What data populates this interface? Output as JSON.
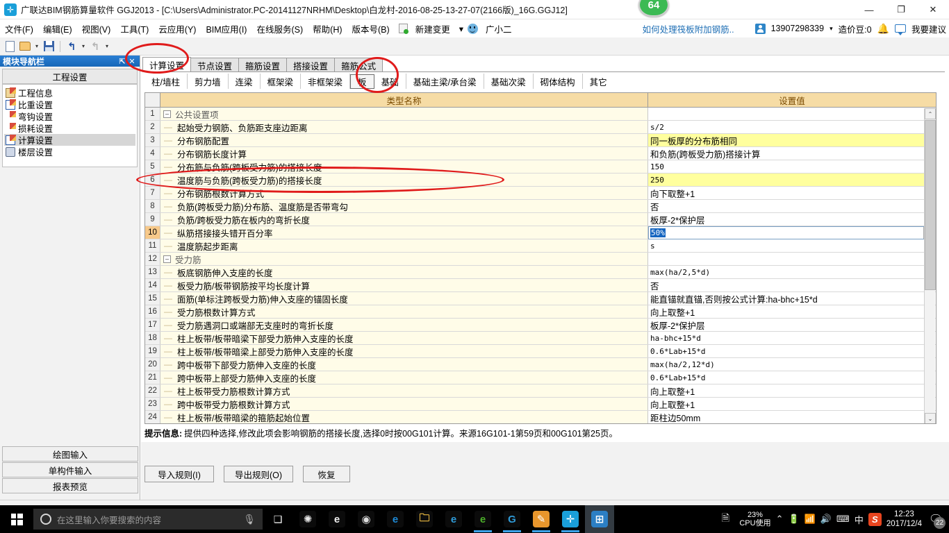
{
  "titlebar": {
    "app_title": "广联达BIM钢筋算量软件 GGJ2013 - [C:\\Users\\Administrator.PC-20141127NRHM\\Desktop\\白龙村-2016-08-25-13-27-07(2166版)_16G.GGJ12]",
    "badge": "64",
    "minimize": "—",
    "maximize": "❐",
    "close": "✕"
  },
  "menubar": {
    "items": [
      "文件(F)",
      "编辑(E)",
      "视图(V)",
      "工具(T)",
      "云应用(Y)",
      "BIM应用(I)",
      "在线服务(S)",
      "帮助(H)",
      "版本号(B)"
    ],
    "new_change": "新建变更",
    "new_change_caret": "▾",
    "assistant": "广小二",
    "right": {
      "promo_link": "如何处理筏板附加钢筋..",
      "account": "13907298339",
      "account_caret": "▾",
      "coins": "造价豆:0",
      "suggest": "我要建议"
    }
  },
  "toolbar": {
    "new": "new-document",
    "open": "open-folder",
    "save": "save-disk",
    "undo": "undo-arrow",
    "redo": "redo-arrow",
    "caret": "▾"
  },
  "left_panel": {
    "header_title": "模块导航栏",
    "pin": "⇱",
    "close": "✕",
    "group_title": "工程设置",
    "tree": [
      {
        "label": "工程信息"
      },
      {
        "label": "比重设置"
      },
      {
        "label": "弯钩设置"
      },
      {
        "label": "损耗设置"
      },
      {
        "label": "计算设置",
        "selected": true
      },
      {
        "label": "楼层设置"
      }
    ],
    "bottom_buttons": [
      "绘图输入",
      "单构件输入",
      "报表预览"
    ]
  },
  "tabs_primary": [
    {
      "label": "计算设置",
      "active": true
    },
    {
      "label": "节点设置",
      "active": false
    },
    {
      "label": "箍筋设置",
      "active": false
    },
    {
      "label": "搭接设置",
      "active": false
    },
    {
      "label": "箍筋公式",
      "active": false
    }
  ],
  "tabs_secondary": [
    {
      "label": "柱/墙柱",
      "active": false
    },
    {
      "label": "剪力墙",
      "active": false
    },
    {
      "label": "连梁",
      "active": false
    },
    {
      "label": "框架梁",
      "active": false
    },
    {
      "label": "非框架梁",
      "active": false
    },
    {
      "label": "板",
      "active": true
    },
    {
      "label": "基础",
      "active": false
    },
    {
      "label": "基础主梁/承台梁",
      "active": false
    },
    {
      "label": "基础次梁",
      "active": false
    },
    {
      "label": "砌体结构",
      "active": false
    },
    {
      "label": "其它",
      "active": false
    }
  ],
  "grid": {
    "columns": [
      "类型名称",
      "设置值"
    ],
    "rows": [
      {
        "n": "1",
        "kind": "group",
        "name": "公共设置项",
        "value": ""
      },
      {
        "n": "2",
        "kind": "item",
        "name": "起始受力钢筋、负筋距支座边距离",
        "value": "s/2"
      },
      {
        "n": "3",
        "kind": "item",
        "name": "分布钢筋配置",
        "value": "同一板厚的分布筋相同",
        "highlight": true,
        "cjk": true
      },
      {
        "n": "4",
        "kind": "item",
        "name": "分布钢筋长度计算",
        "value": "和负筋(跨板受力筋)搭接计算",
        "cjk": true
      },
      {
        "n": "5",
        "kind": "item",
        "name": "分布筋与负筋(跨板受力筋)的搭接长度",
        "value": "150"
      },
      {
        "n": "6",
        "kind": "item",
        "name": "温度筋与负筋(跨板受力筋)的搭接长度",
        "value": "250",
        "highlight": true
      },
      {
        "n": "7",
        "kind": "item",
        "name": "分布钢筋根数计算方式",
        "value": "向下取整+1",
        "cjk": true
      },
      {
        "n": "8",
        "kind": "item",
        "name": "负筋(跨板受力筋)分布筋、温度筋是否带弯勾",
        "value": "否",
        "cjk": true
      },
      {
        "n": "9",
        "kind": "item",
        "name": "负筋/跨板受力筋在板内的弯折长度",
        "value": "板厚-2*保护层",
        "cjk": true
      },
      {
        "n": "10",
        "kind": "combo",
        "name": "纵筋搭接接头错开百分率",
        "value": "50%",
        "current": true
      },
      {
        "n": "11",
        "kind": "item",
        "name": "温度筋起步距离",
        "value": "s"
      },
      {
        "n": "12",
        "kind": "group",
        "name": "受力筋",
        "value": ""
      },
      {
        "n": "13",
        "kind": "item",
        "name": "板底钢筋伸入支座的长度",
        "value": "max(ha/2,5*d)"
      },
      {
        "n": "14",
        "kind": "item",
        "name": "板受力筋/板带钢筋按平均长度计算",
        "value": "否",
        "cjk": true
      },
      {
        "n": "15",
        "kind": "item",
        "name": "面筋(单标注跨板受力筋)伸入支座的锚固长度",
        "value": "能直锚就直锚,否则按公式计算:ha-bhc+15*d",
        "cjk": true
      },
      {
        "n": "16",
        "kind": "item",
        "name": "受力筋根数计算方式",
        "value": "向上取整+1",
        "cjk": true
      },
      {
        "n": "17",
        "kind": "item",
        "name": "受力筋遇洞口或端部无支座时的弯折长度",
        "value": "板厚-2*保护层",
        "cjk": true
      },
      {
        "n": "18",
        "kind": "item",
        "name": "柱上板带/板带暗梁下部受力筋伸入支座的长度",
        "value": "ha-bhc+15*d"
      },
      {
        "n": "19",
        "kind": "item",
        "name": "柱上板带/板带暗梁上部受力筋伸入支座的长度",
        "value": "0.6*Lab+15*d"
      },
      {
        "n": "20",
        "kind": "item",
        "name": "跨中板带下部受力筋伸入支座的长度",
        "value": "max(ha/2,12*d)"
      },
      {
        "n": "21",
        "kind": "item",
        "name": "跨中板带上部受力筋伸入支座的长度",
        "value": "0.6*Lab+15*d"
      },
      {
        "n": "22",
        "kind": "item",
        "name": "柱上板带受力筋根数计算方式",
        "value": "向上取整+1",
        "cjk": true
      },
      {
        "n": "23",
        "kind": "item",
        "name": "跨中板带受力筋根数计算方式",
        "value": "向上取整+1",
        "cjk": true
      },
      {
        "n": "24",
        "kind": "item",
        "name": "柱上板带/板带暗梁的箍筋起始位置",
        "value": "距柱边50mm",
        "cjk": true
      }
    ],
    "scroll": {
      "up": "⌃",
      "down": "⌄"
    }
  },
  "hint": {
    "label": "提示信息:",
    "text": "提供四种选择,修改此项会影响钢筋的搭接长度,选择0时按00G101计算。来源16G101-1第59页和00G101第25页。"
  },
  "buttons": [
    {
      "label": "导入规则(I)"
    },
    {
      "label": "导出规则(O)"
    },
    {
      "label": "恢复"
    }
  ],
  "taskbar": {
    "start": "windows-logo",
    "search_placeholder": "在这里输入你要搜索的内容",
    "mic": "🎤",
    "task_view": "task-view",
    "apps": [
      {
        "name": "fan-app",
        "glyph": "✺",
        "bg": "#0b0b0b",
        "color": "#e8e8e8"
      },
      {
        "name": "ie-classic-app",
        "glyph": "e",
        "bg": "#0b0b0b",
        "color": "#f0f0f0"
      },
      {
        "name": "spiral-app",
        "glyph": "◉",
        "bg": "#0b0b0b",
        "color": "#dddddd"
      },
      {
        "name": "edge-app",
        "glyph": "e",
        "bg": "#0b0b0b",
        "color": "#1e8ad6"
      },
      {
        "name": "explorer-app",
        "glyph": "🗀",
        "bg": "#0b0b0b",
        "color": "#ffca45"
      },
      {
        "name": "ie-app",
        "glyph": "e",
        "bg": "#0b0b0b",
        "color": "#2f9bd8"
      },
      {
        "name": "green-browser-app",
        "glyph": "e",
        "bg": "#0b0b0b",
        "color": "#4caf2a"
      },
      {
        "name": "g-browser-app",
        "glyph": "G",
        "bg": "#0b0b0b",
        "color": "#2f9bd8"
      },
      {
        "name": "notes-app",
        "glyph": "✎",
        "bg": "#e9962c",
        "color": "#ffffff"
      },
      {
        "name": "glodon-app",
        "glyph": "✛",
        "bg": "#1a9fd9",
        "color": "#ffffff"
      },
      {
        "name": "glodon-app-2",
        "glyph": "⊞",
        "bg": "#2c7fc4",
        "color": "#ffffff"
      }
    ],
    "tray": {
      "doc_help": "doc-help-icon",
      "cpu_pct": "23%",
      "cpu_label": "CPU使用",
      "chevron": "⌃",
      "power": "🔌",
      "wifi": "📶",
      "volume": "🔊",
      "keyboard": "⌨",
      "ime": "中",
      "sogou": "S",
      "time": "12:23",
      "date": "2017/12/4",
      "notifications": "22"
    }
  },
  "annotations": {
    "color": "#e01b1b",
    "marks": [
      "tab-calc-settings-circle",
      "tab-slab-circle",
      "row-6-ellipse"
    ]
  }
}
